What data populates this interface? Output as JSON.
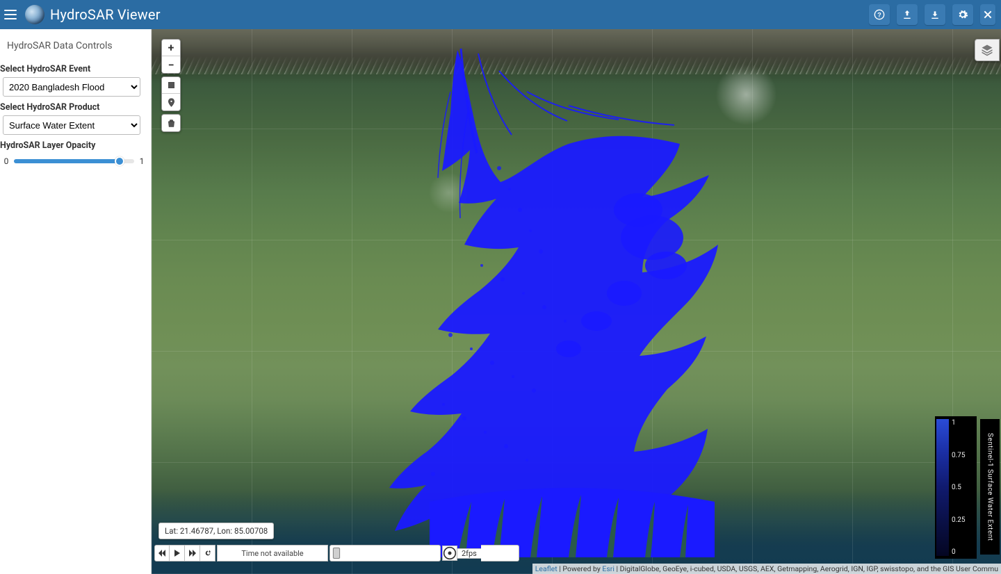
{
  "header": {
    "title": "HydroSAR Viewer",
    "buttons": {
      "help": "?",
      "upload": "Upload",
      "download": "Download",
      "settings": "Settings",
      "close": "✕"
    }
  },
  "sidebar": {
    "title": "HydroSAR Data Controls",
    "event": {
      "label": "Select HydroSAR Event",
      "value": "2020 Bangladesh Flood"
    },
    "product": {
      "label": "Select HydroSAR Product",
      "value": "Surface Water Extent"
    },
    "opacity": {
      "label": "HydroSAR Layer Opacity",
      "min": "0",
      "max": "1",
      "value": 0.88
    }
  },
  "map": {
    "latlon": "Lat: 21.46787, Lon: 85.00708",
    "attribution": {
      "leaflet": "Leaflet",
      "powered_prefix": " | Powered by ",
      "esri": "Esri",
      "rest": " | DigitalGlobe, GeoEye, i-cubed, USDA, USGS, AEX, Getmapping, Aerogrid, IGN, IGP, swisstopo, and the GIS User Commu"
    }
  },
  "legend": {
    "title": "Sentinel-1 Surface Water Extent",
    "ticks": [
      "1",
      "0.75",
      "0.5",
      "0.25",
      "0"
    ]
  },
  "time": {
    "label": "Time not available",
    "fps_label": "2fps"
  },
  "colors": {
    "header": "#2b6ca3",
    "sar": "#1a1aff"
  }
}
